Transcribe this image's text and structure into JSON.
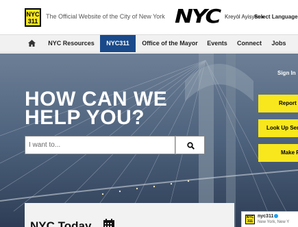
{
  "header": {
    "logo_line1": "NYC",
    "logo_line2": "311",
    "tagline": "The Official Website of the City of New York",
    "nyc_logo": "NYC",
    "lang_link": "Kreyòl Ayisyen ▸",
    "lang_select": "Select Language"
  },
  "nav": {
    "home_icon": "home-icon",
    "items": [
      {
        "label": "NYC Resources"
      },
      {
        "label": "NYC311"
      },
      {
        "label": "Office of the Mayor"
      },
      {
        "label": "Events"
      },
      {
        "label": "Connect"
      },
      {
        "label": "Jobs"
      }
    ],
    "active": "NYC311"
  },
  "hero": {
    "headline": "HOW CAN WE HELP YOU?",
    "search_placeholder": "I want to...",
    "search_icon": "search-icon",
    "signin": "Sign In",
    "report_label": "Report a Problem",
    "lookup_label": "Look Up Service Requests",
    "make_label": "Make Payments"
  },
  "today": {
    "title": "NYC Today",
    "icon": "calendar-icon"
  },
  "tweet": {
    "avatar_line1": "NYC",
    "avatar_line2": "311",
    "name": "nyc311",
    "location": "New York, New Y"
  },
  "colors": {
    "accent_yellow": "#f8e71c",
    "nav_active": "#1a4a8a"
  }
}
